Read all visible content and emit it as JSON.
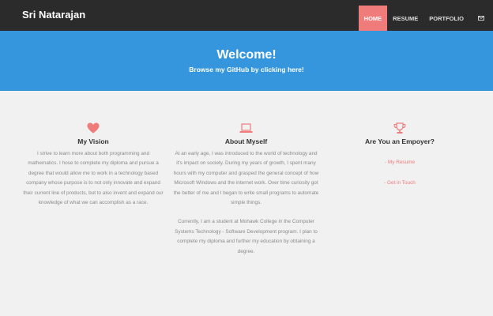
{
  "navbar": {
    "brand": "Sri Natarajan",
    "items": [
      {
        "label": "HOME"
      },
      {
        "label": "RESUME"
      },
      {
        "label": "PORTFOLIO"
      }
    ],
    "envelope_icon": "envelope-icon"
  },
  "hero": {
    "title": "Welcome!",
    "subtitle": "Browse my GitHub by clicking here!"
  },
  "columns": {
    "vision": {
      "icon": "heart-icon",
      "title": "My Vision",
      "text": "I strive to learn more about both programming and mathematics. I hose to complete my diploma and pursue a degree that would allow me to work in a technology based company whose purpose is to not only innovate and expand their current line of products, but to also invent and expand our knowledge of what we can accomplish as a race."
    },
    "about": {
      "icon": "laptop-icon",
      "title": "About Myself",
      "paragraphs": [
        "At an early age, I was introduced to the world of technology and it's impact on society. During my years of growth, I spent many hours with my computer and grasped the general concept of how Microsoft Windows and the internet work. Over time curiosity got the better of me and I began to write small programs to automate simple things.",
        "Currently, I am a student at Mohawk College in the Computer Systems Technology - Software Development program. I plan to complete my diploma and further my education by obtaining a degree."
      ]
    },
    "employer": {
      "icon": "trophy-icon",
      "title": "Are You an Empoyer?",
      "links": [
        "- My Resume",
        "- Get in Touch"
      ]
    }
  },
  "colors": {
    "navbar_bg": "#2b2b2b",
    "accent": "#ef7b7a",
    "hero_bg": "#3596dd",
    "page_bg": "#f1f1f1"
  }
}
